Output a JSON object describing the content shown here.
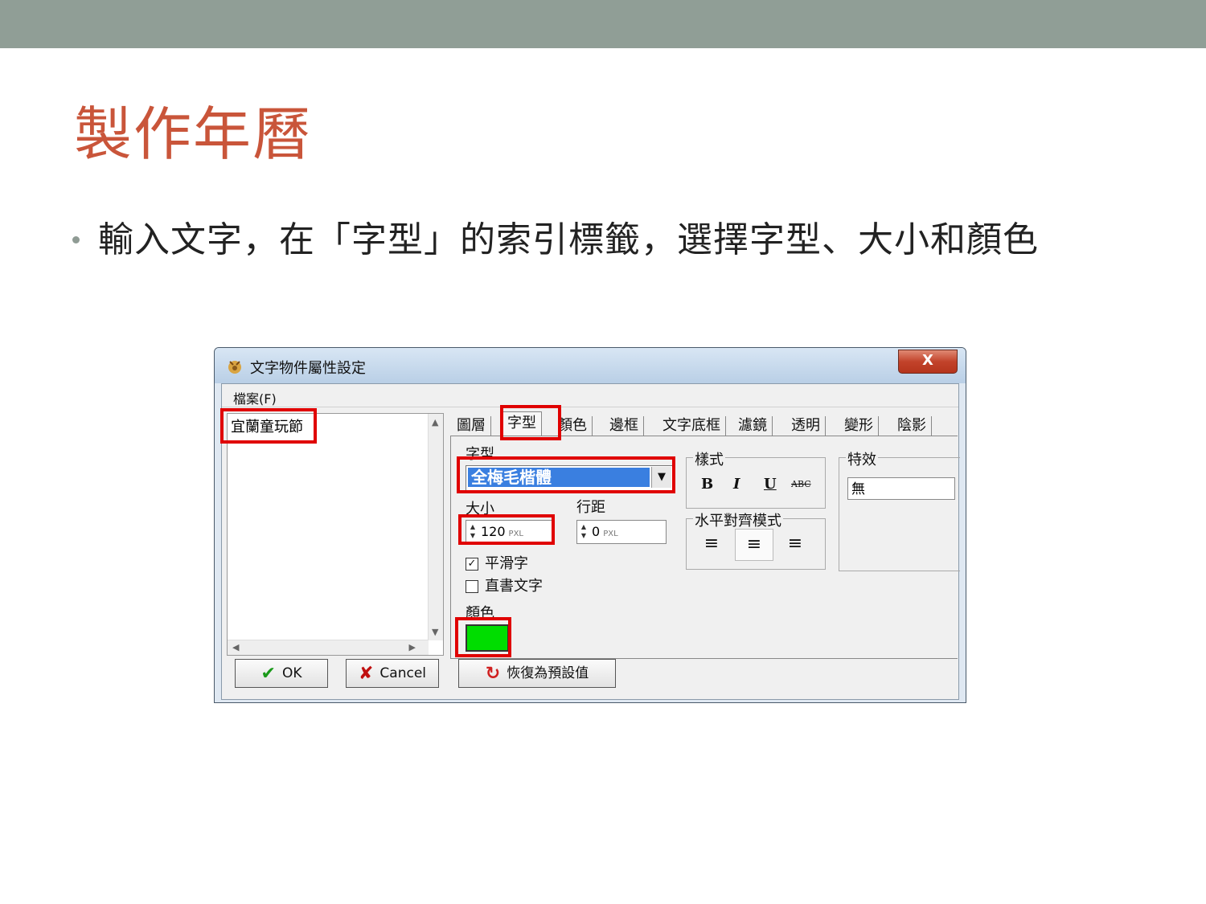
{
  "slide": {
    "title": "製作年曆",
    "bullet": "輸入文字，在「字型」的索引標籤，選擇字型、大小和顏色"
  },
  "dialog": {
    "title": "文字物件屬性設定",
    "close_label": "X",
    "menu": {
      "file": "檔案(F)"
    },
    "list": {
      "items": [
        "宜蘭童玩節"
      ]
    },
    "tabs": [
      "圖層",
      "字型",
      "顏色",
      "邊框",
      "文字底框",
      "濾鏡",
      "透明",
      "變形",
      "陰影"
    ],
    "active_tab": "字型",
    "font_tab": {
      "font_label": "字型",
      "font_value": "全梅毛楷體",
      "size_label": "大小",
      "size_value": "120",
      "size_unit": "PXL",
      "spacing_label": "行距",
      "spacing_value": "0",
      "spacing_unit": "PXL",
      "smooth_label": "平滑字",
      "smooth_checked": true,
      "vertical_label": "直書文字",
      "vertical_checked": false,
      "color_label": "顏色",
      "color_value": "#00dd00",
      "style_group": "樣式",
      "style_buttons": {
        "bold": "B",
        "italic": "I",
        "underline": "U",
        "strike": "ABC"
      },
      "align_group": "水平對齊模式",
      "effect_group": "特效",
      "effect_value": "無"
    },
    "buttons": {
      "ok": "OK",
      "cancel": "Cancel",
      "reset": "恢復為預設值"
    }
  },
  "colors": {
    "topbar": "#909e96",
    "title": "#c9553a",
    "highlight": "#e00000"
  }
}
